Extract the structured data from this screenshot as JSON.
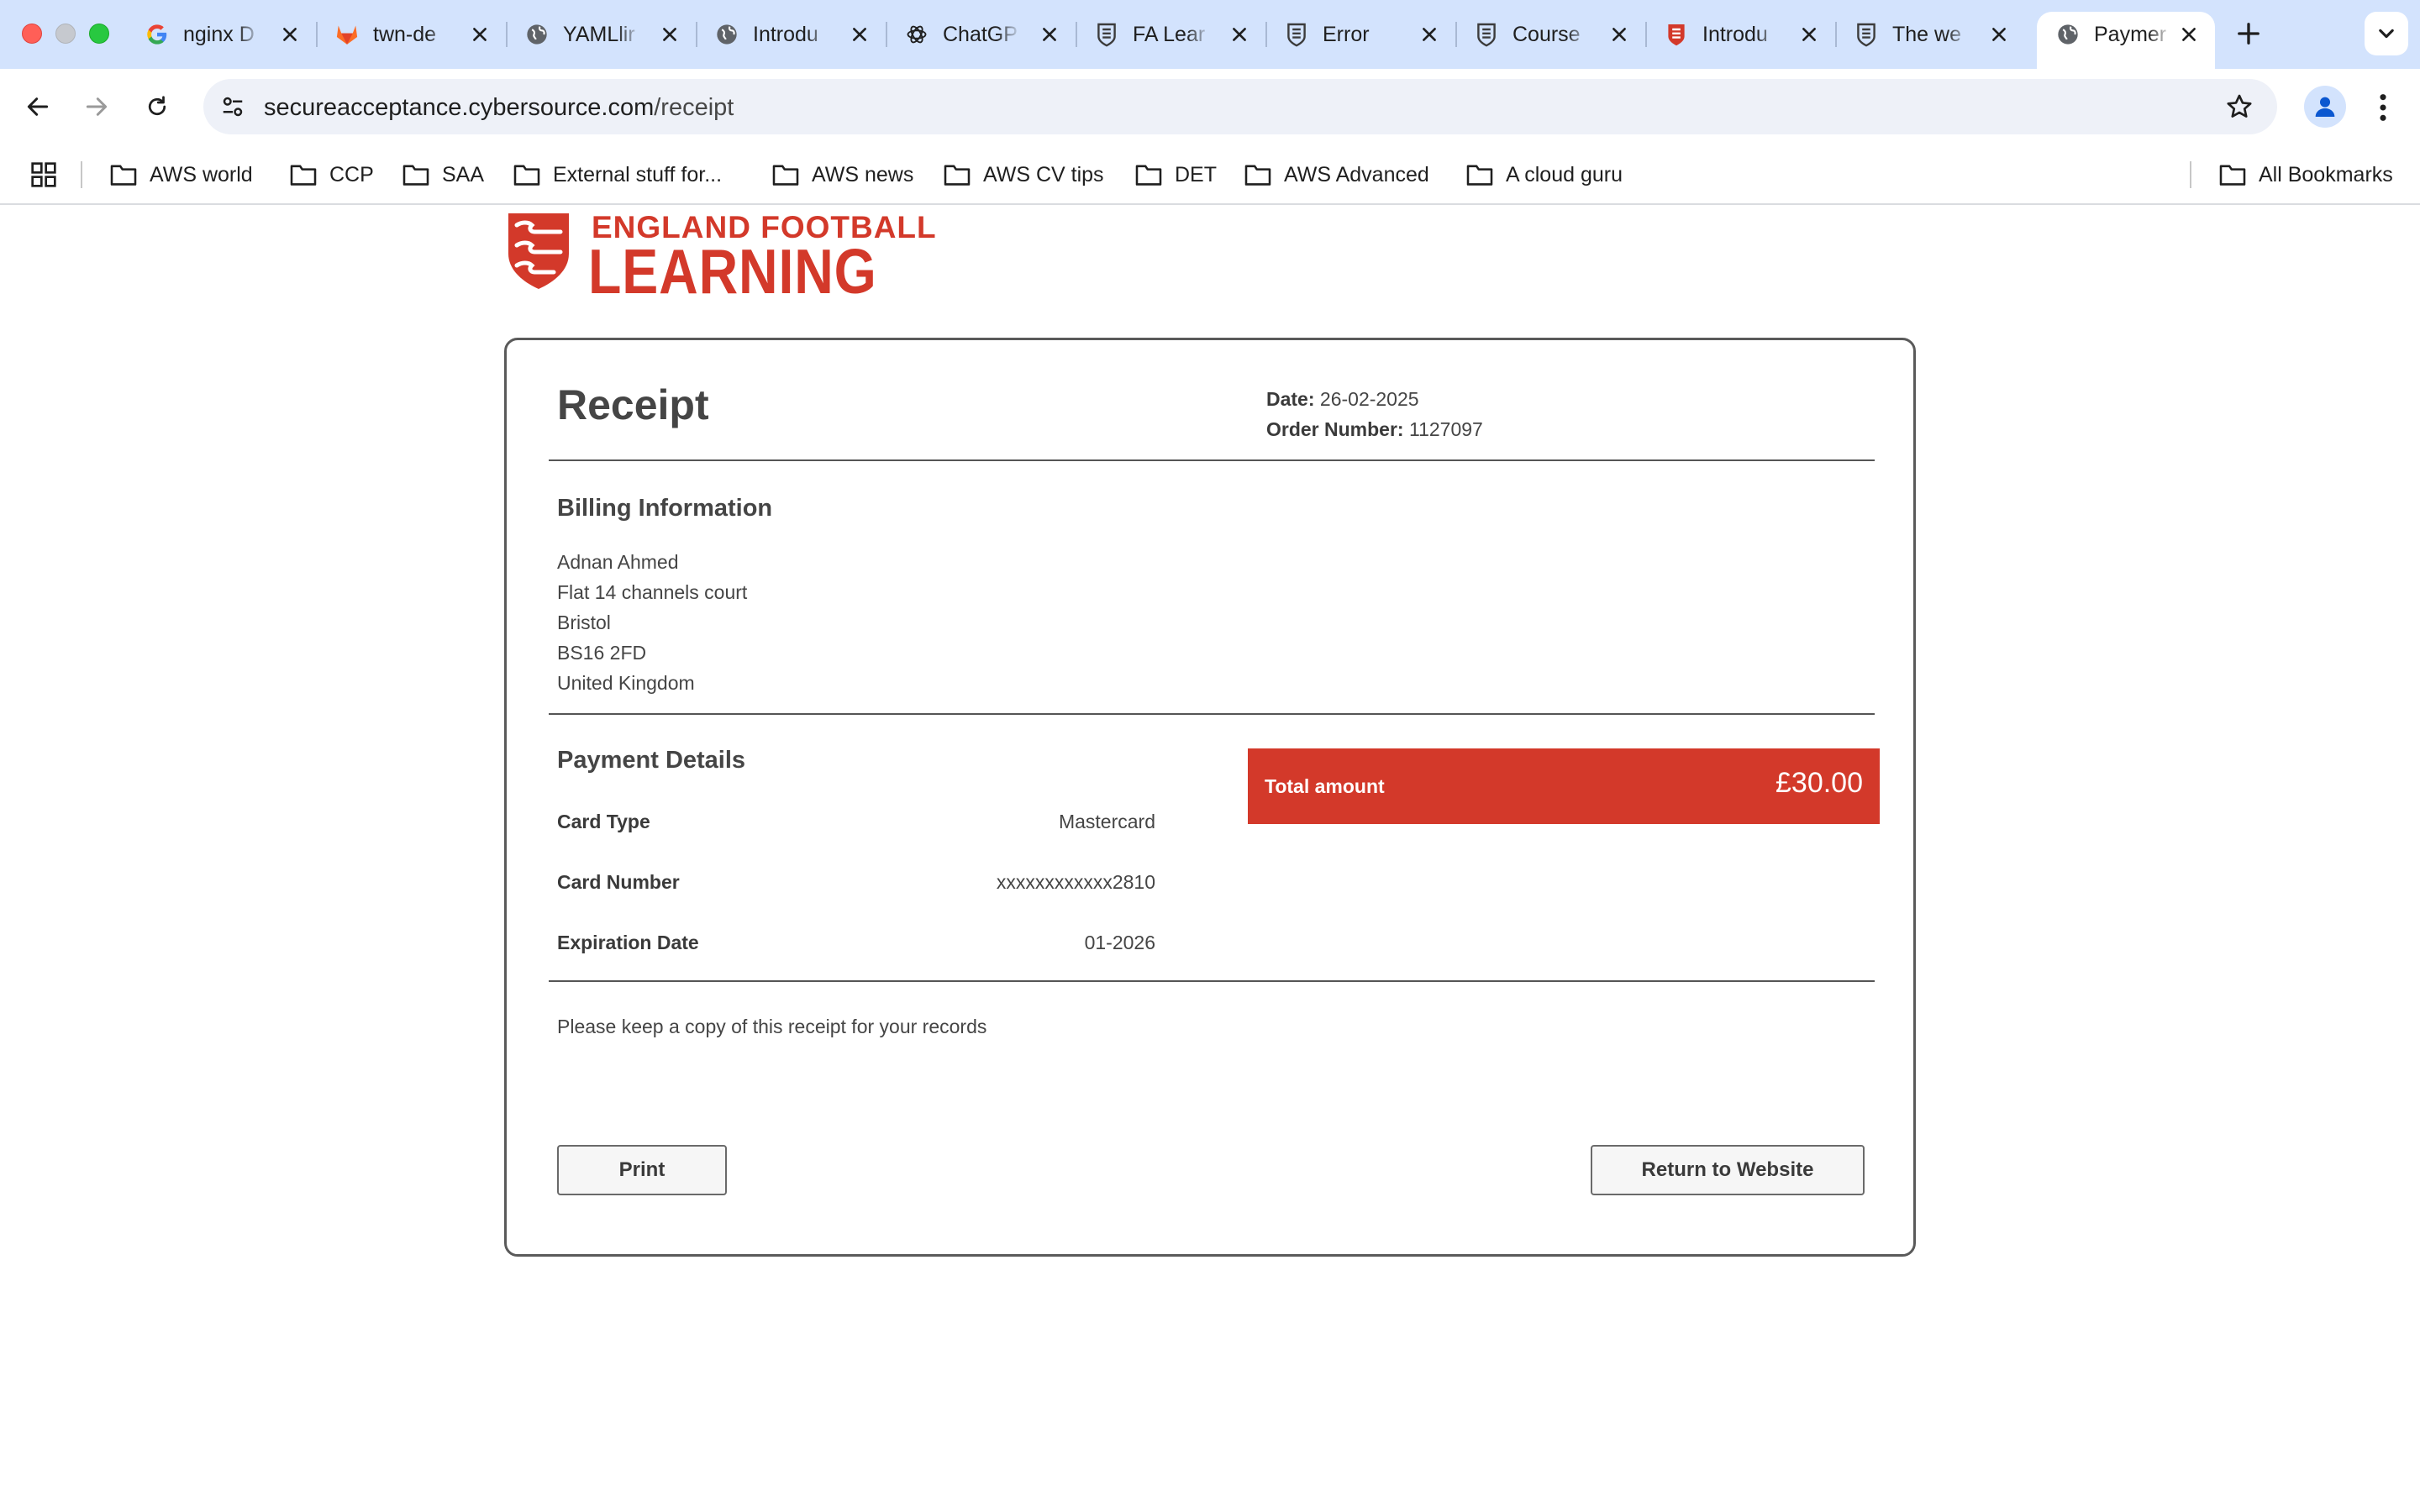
{
  "browser": {
    "tabs": [
      {
        "title": "nginx D",
        "icon": "google-icon"
      },
      {
        "title": "twn-de",
        "icon": "gitlab-icon"
      },
      {
        "title": "YAMLlir",
        "icon": "globe-icon"
      },
      {
        "title": "Introdu",
        "icon": "globe-icon"
      },
      {
        "title": "ChatGP",
        "icon": "openai-icon"
      },
      {
        "title": "FA Lear",
        "icon": "fa-crest-icon"
      },
      {
        "title": "Error",
        "icon": "fa-crest-icon"
      },
      {
        "title": "Course",
        "icon": "fa-crest-icon"
      },
      {
        "title": "Introdu",
        "icon": "red-crest-icon"
      },
      {
        "title": "The we",
        "icon": "fa-crest-icon"
      },
      {
        "title": "Paymer",
        "icon": "globe-icon",
        "active": true
      }
    ],
    "url": {
      "host": "secureacceptance.cybersource.com",
      "path": "/receipt"
    },
    "bookmarks": [
      "AWS world",
      "CCP",
      "SAA",
      "External stuff for...",
      "AWS news",
      "AWS CV tips",
      "DET",
      "AWS Advanced",
      "A cloud guru"
    ],
    "all_bookmarks": "All Bookmarks"
  },
  "brand": {
    "line1": "ENGLAND FOOTBALL",
    "line2": "LEARNING",
    "color": "#d3392a"
  },
  "receipt": {
    "title": "Receipt",
    "date_label": "Date:",
    "date": "26-02-2025",
    "order_label": "Order Number:",
    "order_number": "1127097",
    "billing_title": "Billing Information",
    "billing": {
      "name": "Adnan Ahmed",
      "address1": "Flat 14 channels court",
      "city": "Bristol",
      "postcode": "BS16 2FD",
      "country": "United Kingdom"
    },
    "payment_title": "Payment Details",
    "payment": [
      {
        "label": "Card Type",
        "value": "Mastercard"
      },
      {
        "label": "Card Number",
        "value": "xxxxxxxxxxxx2810"
      },
      {
        "label": "Expiration Date",
        "value": "01-2026"
      }
    ],
    "total_label": "Total amount",
    "total_amount": "£30.00",
    "note": "Please keep a copy of this receipt for your records",
    "print_label": "Print",
    "return_label": "Return to Website"
  }
}
